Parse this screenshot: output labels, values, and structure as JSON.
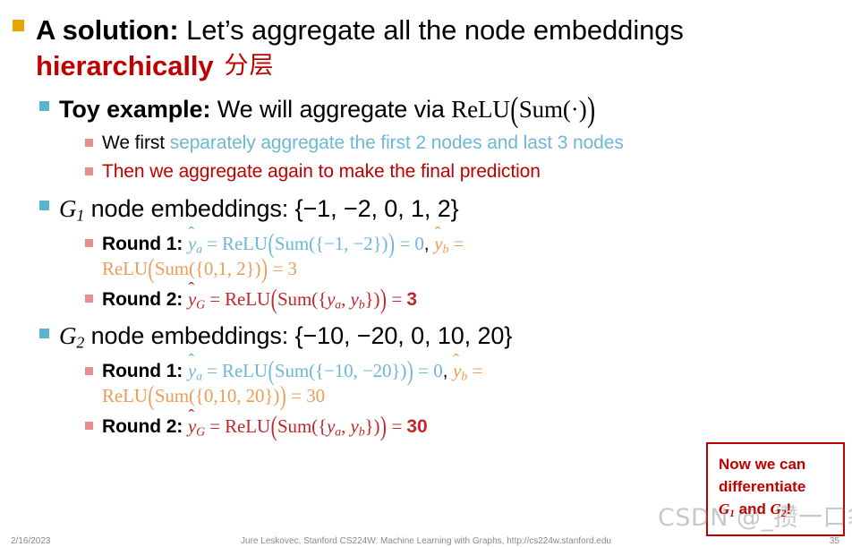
{
  "slide": {
    "level1": {
      "label_bold": "A solution:",
      "text": " Let’s aggregate all the node embeddings ",
      "emphasis": "hierarchically",
      "annotation_cn": "分层"
    },
    "toy_example": {
      "label_bold": "Toy example:",
      "text": " We will aggregate via ",
      "formula": "ReLU(Sum(·))"
    },
    "sub_points": [
      {
        "black_part": "We first ",
        "blue_part": "separately aggregate the first 2 nodes and last 3 nodes"
      },
      {
        "red_part": "Then we aggregate again to make the final prediction"
      }
    ],
    "g1": {
      "symbol": "G",
      "subscript": "1",
      "text": " node embeddings: {−1, −2, 0, 1, 2}",
      "round1": {
        "label": "Round 1",
        "colon": ": ",
        "blue_expr": "ŷa = ReLU(Sum({−1, −2})) = 0",
        "comma": ", ",
        "orange_expr_head": "ŷb =",
        "orange_expr_tail": "ReLU(Sum({0,1, 2})) = 3"
      },
      "round2": {
        "label": "Round 2",
        "colon": ": ",
        "red_expr": "ŷG = ReLU(Sum({ya, yb})) = ",
        "result": "3"
      }
    },
    "g2": {
      "symbol": "G",
      "subscript": "2",
      "text": " node embeddings: {−10, −20, 0, 10, 20}",
      "round1": {
        "label": "Round 1",
        "colon": ": ",
        "blue_expr": "ŷa = ReLU(Sum({−10, −20})) = 0",
        "comma": ", ",
        "orange_expr_head": "ŷb =",
        "orange_expr_tail": "ReLU(Sum({0,10, 20})) = 30"
      },
      "round2": {
        "label": "Round 2",
        "colon": ": ",
        "red_expr": "ŷG = ReLU(Sum({ya, yb})) = ",
        "result": "30"
      }
    },
    "callout": {
      "line1": "Now we can",
      "line2": "differentiate",
      "line3_a": "G",
      "line3_sub_a": "1",
      "line3_mid": " and ",
      "line3_b": "G",
      "line3_sub_b": "2",
      "line3_end": "!"
    },
    "watermark": "CSDN @_攒一口袋星星",
    "footer": {
      "date": "2/16/2023",
      "citation": "Jure Leskovec, Stanford CS224W: Machine Learning with Graphs, http://cs224w.stanford.edu",
      "page": "35"
    },
    "colors": {
      "bullet_l1": "#e8a400",
      "bullet_l2": "#5bb3cc",
      "bullet_l3": "#ea8d8d",
      "red": "#c00000",
      "blue": "#6cb8d6",
      "orange": "#ed9b58"
    }
  }
}
